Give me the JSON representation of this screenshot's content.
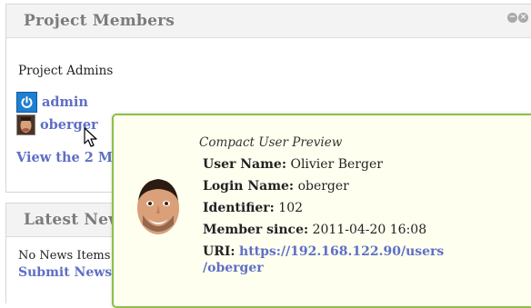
{
  "members_widget": {
    "title": "Project Members",
    "controls": [
      "minimize-icon",
      "close-icon"
    ],
    "section_label": "Project Admins",
    "members": [
      {
        "name": "admin",
        "icon": "power-icon"
      },
      {
        "name": "oberger",
        "icon": "user-avatar"
      }
    ],
    "view_all": "View the 2 M"
  },
  "news_widget": {
    "title": "Latest New",
    "empty_text": "No News Items",
    "submit_link": "Submit News"
  },
  "popup": {
    "title": "Compact User Preview",
    "fields": {
      "user_name_label": "User Name:",
      "user_name_value": "Olivier Berger",
      "login_name_label": "Login Name:",
      "login_name_value": "oberger",
      "identifier_label": "Identifier:",
      "identifier_value": "102",
      "member_since_label": "Member since:",
      "member_since_value": "2011-04-20 16:08",
      "uri_label": "URI:",
      "uri_value_1": "https://192.168.122.90/users",
      "uri_value_2": "/oberger"
    }
  },
  "colors": {
    "link": "#5e6fc4",
    "popup_border": "#8dbf4c",
    "popup_background": "#fffff0",
    "header_title": "#7b7b7b"
  }
}
